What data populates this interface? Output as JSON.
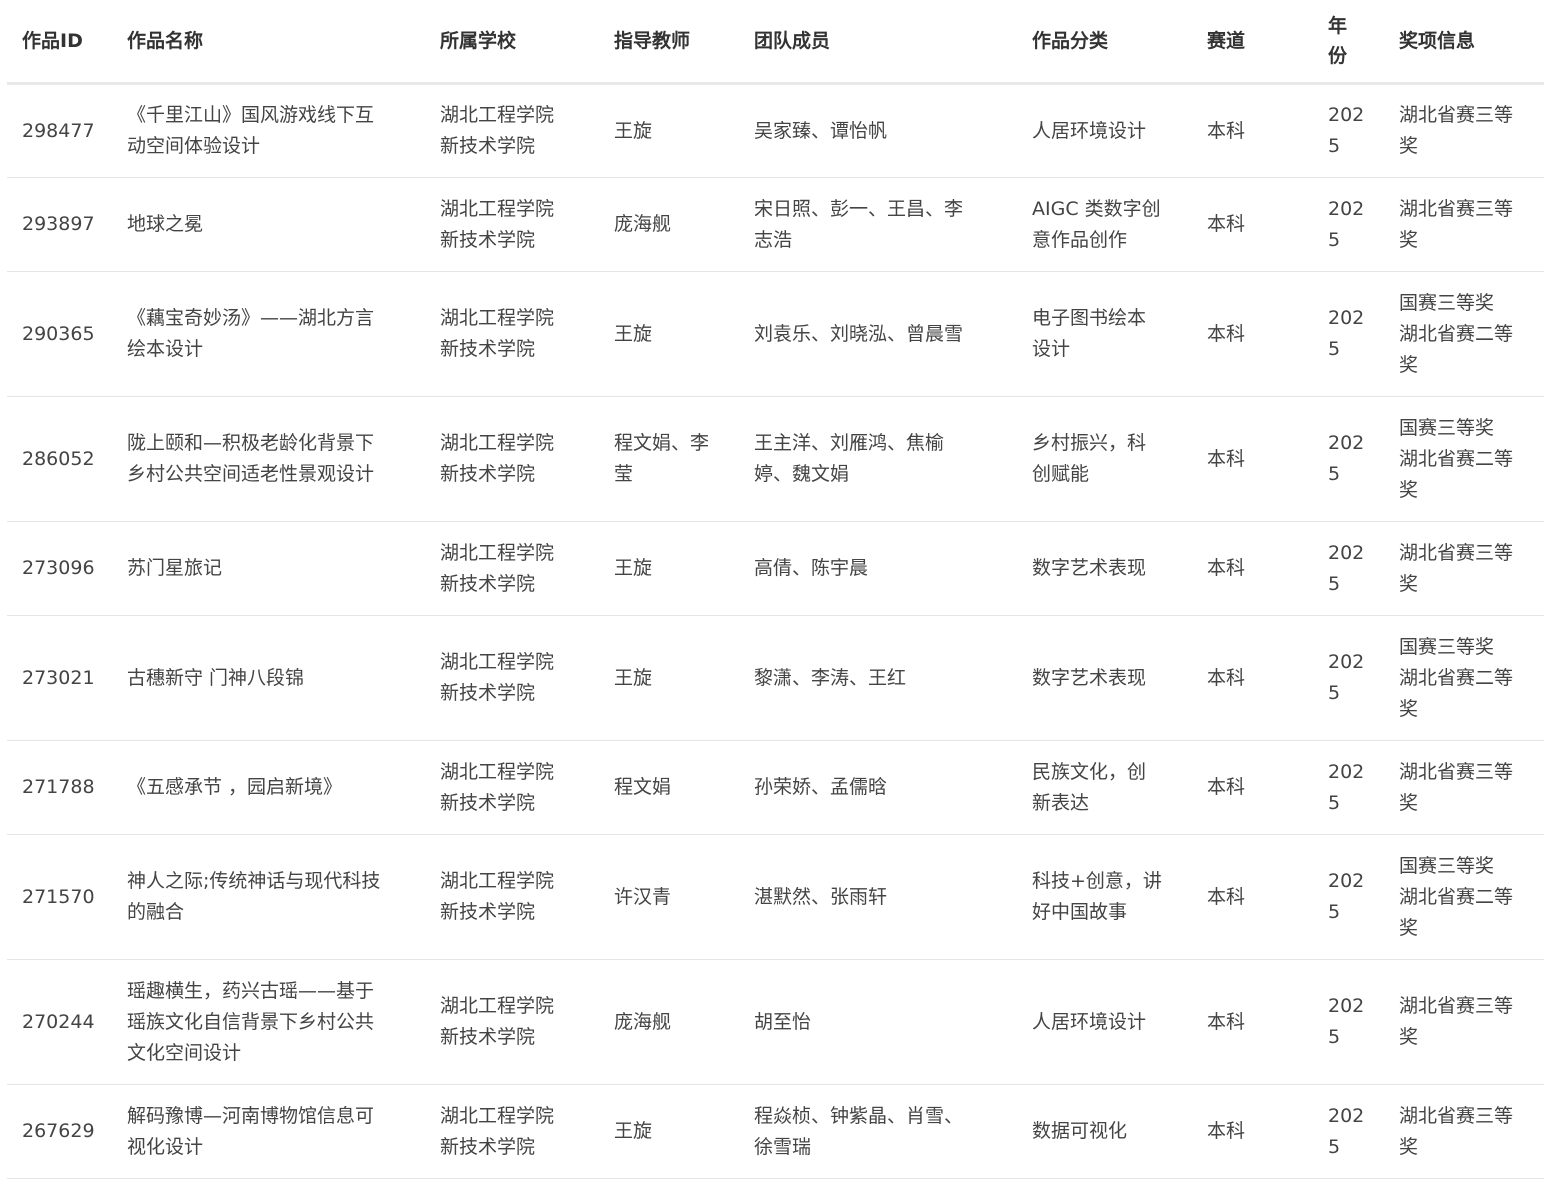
{
  "columns": [
    {
      "key": "id",
      "label": "作品ID"
    },
    {
      "key": "name",
      "label": "作品名称"
    },
    {
      "key": "school",
      "label": "所属学校"
    },
    {
      "key": "teacher",
      "label": "指导教师"
    },
    {
      "key": "members",
      "label": "团队成员"
    },
    {
      "key": "category",
      "label": "作品分类"
    },
    {
      "key": "track",
      "label": "赛道"
    },
    {
      "key": "year",
      "label": "年\n份"
    },
    {
      "key": "award",
      "label": "奖项信息"
    }
  ],
  "rows": [
    {
      "id": "298477",
      "name": "《千里江山》国风游戏线下互\n动空间体验设计",
      "school": "湖北工程学院\n新技术学院",
      "teacher": "王旋",
      "members": "吴家臻、谭怡帆",
      "category": "人居环境设计",
      "track": "本科",
      "year": "202\n5",
      "award": "湖北省赛三等\n奖"
    },
    {
      "id": "293897",
      "name": "地球之冕",
      "school": "湖北工程学院\n新技术学院",
      "teacher": "庞海舰",
      "members": "宋日照、彭一、王昌、李\n志浩",
      "category": "AIGC 类数字创\n意作品创作",
      "track": "本科",
      "year": "202\n5",
      "award": "湖北省赛三等\n奖"
    },
    {
      "id": "290365",
      "name": "《藕宝奇妙汤》——湖北方言\n绘本设计",
      "school": "湖北工程学院\n新技术学院",
      "teacher": "王旋",
      "members": "刘袁乐、刘晓泓、曾晨雪",
      "category": "电子图书绘本\n设计",
      "track": "本科",
      "year": "202\n5",
      "award": "国赛三等奖\n湖北省赛二等\n奖"
    },
    {
      "id": "286052",
      "name": "陇上颐和—积极老龄化背景下\n乡村公共空间适老性景观设计",
      "school": "湖北工程学院\n新技术学院",
      "teacher": "程文娟、李\n莹",
      "members": "王主洋、刘雁鸿、焦榆\n婷、魏文娟",
      "category": "乡村振兴，科\n创赋能",
      "track": "本科",
      "year": "202\n5",
      "award": "国赛三等奖\n湖北省赛二等\n奖"
    },
    {
      "id": "273096",
      "name": "苏门星旅记",
      "school": "湖北工程学院\n新技术学院",
      "teacher": "王旋",
      "members": "高倩、陈宇晨",
      "category": "数字艺术表现",
      "track": "本科",
      "year": "202\n5",
      "award": "湖北省赛三等\n奖"
    },
    {
      "id": "273021",
      "name": "古穗新守 门神八段锦",
      "school": "湖北工程学院\n新技术学院",
      "teacher": "王旋",
      "members": "黎潇、李涛、王红",
      "category": "数字艺术表现",
      "track": "本科",
      "year": "202\n5",
      "award": "国赛三等奖\n湖北省赛二等\n奖"
    },
    {
      "id": "271788",
      "name": "《五感承节 ，园启新境》",
      "school": "湖北工程学院\n新技术学院",
      "teacher": "程文娟",
      "members": "孙荣娇、孟儒晗",
      "category": "民族文化，创\n新表达",
      "track": "本科",
      "year": "202\n5",
      "award": "湖北省赛三等\n奖"
    },
    {
      "id": "271570",
      "name": "神人之际;传统神话与现代科技\n的融合",
      "school": "湖北工程学院\n新技术学院",
      "teacher": "许汉青",
      "members": "湛默然、张雨轩",
      "category": "科技+创意，讲\n好中国故事",
      "track": "本科",
      "year": "202\n5",
      "award": "国赛三等奖\n湖北省赛二等\n奖"
    },
    {
      "id": "270244",
      "name": "瑶趣横生，药兴古瑶——基于\n瑶族文化自信背景下乡村公共\n文化空间设计",
      "school": "湖北工程学院\n新技术学院",
      "teacher": "庞海舰",
      "members": "胡至怡",
      "category": "人居环境设计",
      "track": "本科",
      "year": "202\n5",
      "award": "湖北省赛三等\n奖"
    },
    {
      "id": "267629",
      "name": "解码豫博—河南博物馆信息可\n视化设计",
      "school": "湖北工程学院\n新技术学院",
      "teacher": "王旋",
      "members": "程焱桢、钟紫晶、肖雪、\n徐雪瑞",
      "category": "数据可视化",
      "track": "本科",
      "year": "202\n5",
      "award": "湖北省赛三等\n奖"
    }
  ]
}
